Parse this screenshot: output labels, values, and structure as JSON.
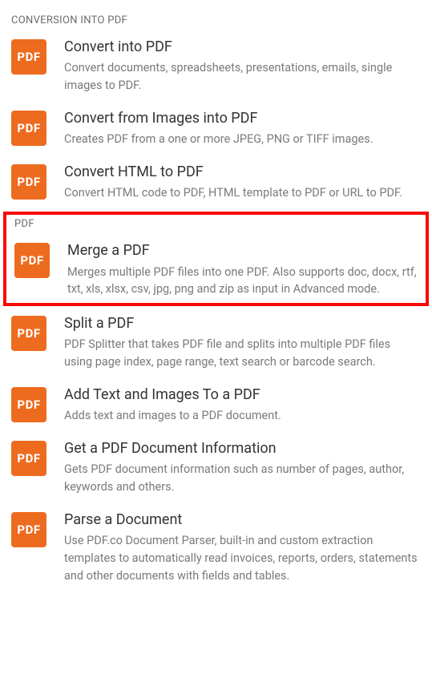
{
  "icon_label": "PDF",
  "sections": {
    "conversion": {
      "header": "CONVERSION INTO PDF",
      "items": {
        "convert_pdf": {
          "title": "Convert into PDF",
          "desc": "Convert documents, spreadsheets, presentations, emails, single images to PDF."
        },
        "convert_images": {
          "title": "Convert from Images into PDF",
          "desc": "Creates PDF from a one or more JPEG, PNG or TIFF images."
        },
        "convert_html": {
          "title": "Convert HTML to PDF",
          "desc": "Convert HTML code to PDF, HTML template to PDF or URL to PDF."
        }
      }
    },
    "pdf": {
      "header": "PDF",
      "items": {
        "merge": {
          "title": "Merge a PDF",
          "desc": "Merges multiple PDF files into one PDF. Also supports doc, docx, rtf, txt, xls, xlsx, csv, jpg, png and zip as input in Advanced mode."
        },
        "split": {
          "title": "Split a PDF",
          "desc": "PDF Splitter that takes PDF file and splits into multiple PDF files using page index, page range, text search or barcode search."
        },
        "add_text": {
          "title": "Add Text and Images To a PDF",
          "desc": "Adds text and images to a PDF document."
        },
        "get_info": {
          "title": "Get a PDF Document Information",
          "desc": "Gets PDF document information such as number of pages, author, keywords and others."
        },
        "parse": {
          "title": "Parse a Document",
          "desc": "Use PDF.co Document Parser, built-in and custom extraction templates to automatically read invoices, reports, orders, statements and other documents with fields and tables."
        }
      }
    }
  }
}
